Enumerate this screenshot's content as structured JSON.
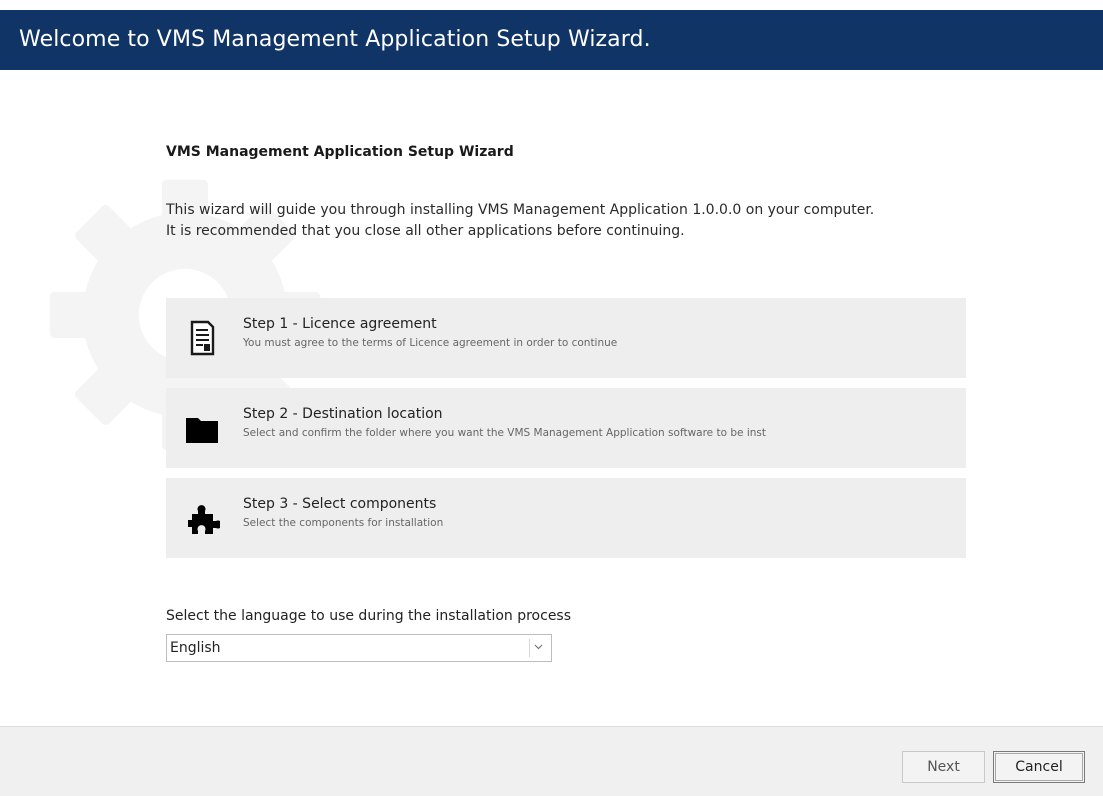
{
  "window": {
    "title": "Welcome to VMS Management Application Setup Wizard.",
    "accent_color": "#0f3465",
    "background_icon": "gear-icon"
  },
  "main": {
    "heading": "VMS Management Application Setup Wizard",
    "intro_line_1": "This wizard will guide you through installing VMS Management Application 1.0.0.0 on your computer.",
    "intro_line_2": "It is recommended that you close all other applications before continuing.",
    "steps": [
      {
        "icon": "document-icon",
        "title": "Step 1 - Licence agreement",
        "description": "You must agree to the terms of Licence agreement in order to continue"
      },
      {
        "icon": "folder-icon",
        "title": "Step 2 - Destination location",
        "description": "Select and confirm the folder where you want the VMS Management Application software to be inst"
      },
      {
        "icon": "puzzle-icon",
        "title": "Step 3 - Select components",
        "description": "Select the components for installation"
      }
    ],
    "language": {
      "label": "Select the language to use during the installation process",
      "selected": "English",
      "dropdown_icon": "chevron-down-icon"
    }
  },
  "footer": {
    "next_label": "Next",
    "cancel_label": "Cancel"
  }
}
